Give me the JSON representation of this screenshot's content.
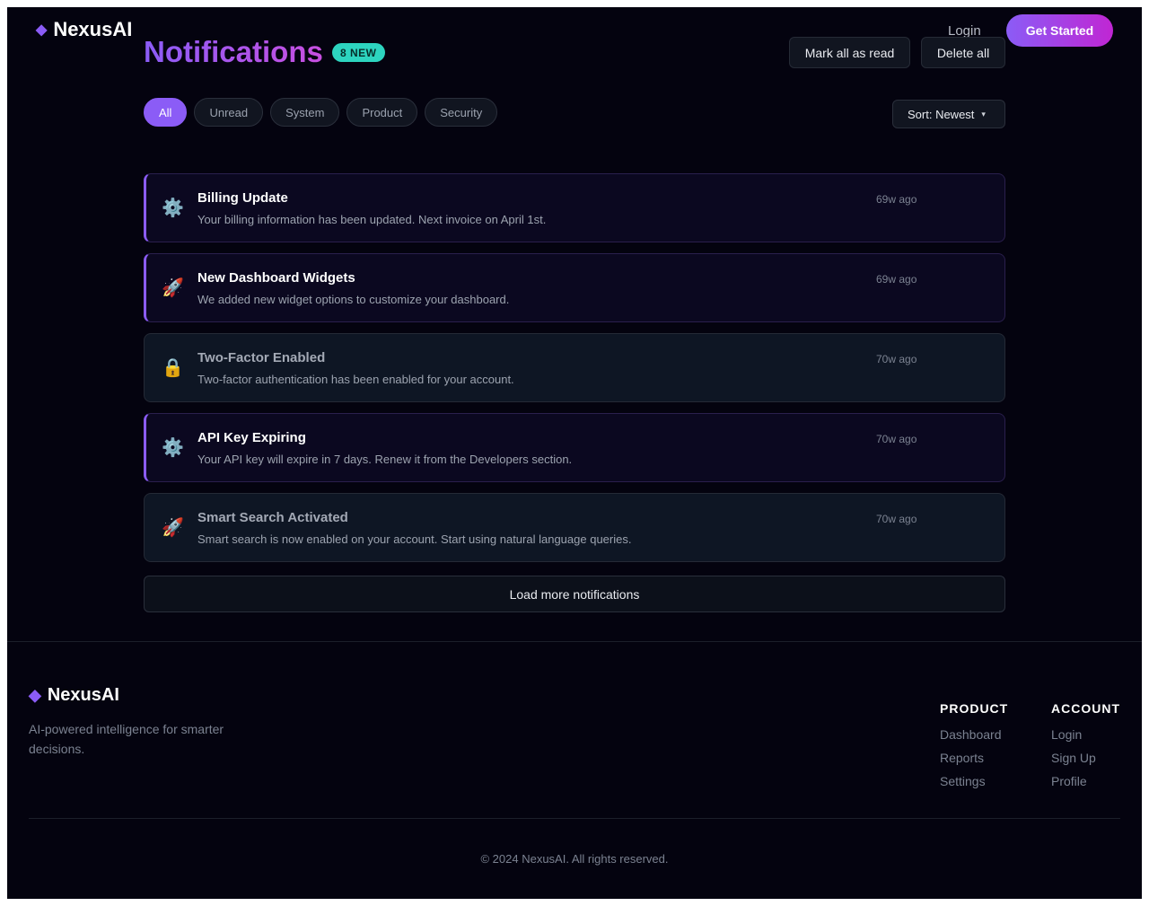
{
  "brand": {
    "name": "NexusAI",
    "gem": "◆"
  },
  "nav": {
    "login": "Login",
    "cta": "Get Started"
  },
  "header": {
    "title": "Notifications",
    "badge": "8 NEW",
    "mark_all": "Mark all as read",
    "delete_all": "Delete all"
  },
  "filters": [
    "All",
    "Unread",
    "System",
    "Product",
    "Security"
  ],
  "active_filter": "All",
  "sort": {
    "label": "Sort: Newest",
    "caret": "▾"
  },
  "notifications": [
    {
      "icon": "gear-icon",
      "glyph": "⚙️",
      "title": "Billing Update",
      "message": "Your billing information has been updated. Next invoice on April 1st.",
      "time": "69w ago",
      "unread": true
    },
    {
      "icon": "rocket-icon",
      "glyph": "🚀",
      "title": "New Dashboard Widgets",
      "message": "We added new widget options to customize your dashboard.",
      "time": "69w ago",
      "unread": true
    },
    {
      "icon": "lock-icon",
      "glyph": "🔒",
      "title": "Two-Factor Enabled",
      "message": "Two-factor authentication has been enabled for your account.",
      "time": "70w ago",
      "unread": false
    },
    {
      "icon": "gear-icon",
      "glyph": "⚙️",
      "title": "API Key Expiring",
      "message": "Your API key will expire in 7 days. Renew it from the Developers section.",
      "time": "70w ago",
      "unread": true
    },
    {
      "icon": "rocket-icon",
      "glyph": "🚀",
      "title": "Smart Search Activated",
      "message": "Smart search is now enabled on your account. Start using natural language queries.",
      "time": "70w ago",
      "unread": false
    }
  ],
  "load_more": "Load more notifications",
  "footer": {
    "tagline": "AI-powered intelligence for smarter decisions.",
    "columns": [
      {
        "heading": "PRODUCT",
        "links": [
          "Dashboard",
          "Reports",
          "Settings"
        ]
      },
      {
        "heading": "ACCOUNT",
        "links": [
          "Login",
          "Sign Up",
          "Profile"
        ]
      }
    ],
    "copyright": "© 2024 NexusAI. All rights reserved."
  },
  "colors": {
    "accent": "#8b5cf6",
    "accent2": "#c026d3",
    "badge": "#2dd4bf",
    "background": "#04030f"
  }
}
